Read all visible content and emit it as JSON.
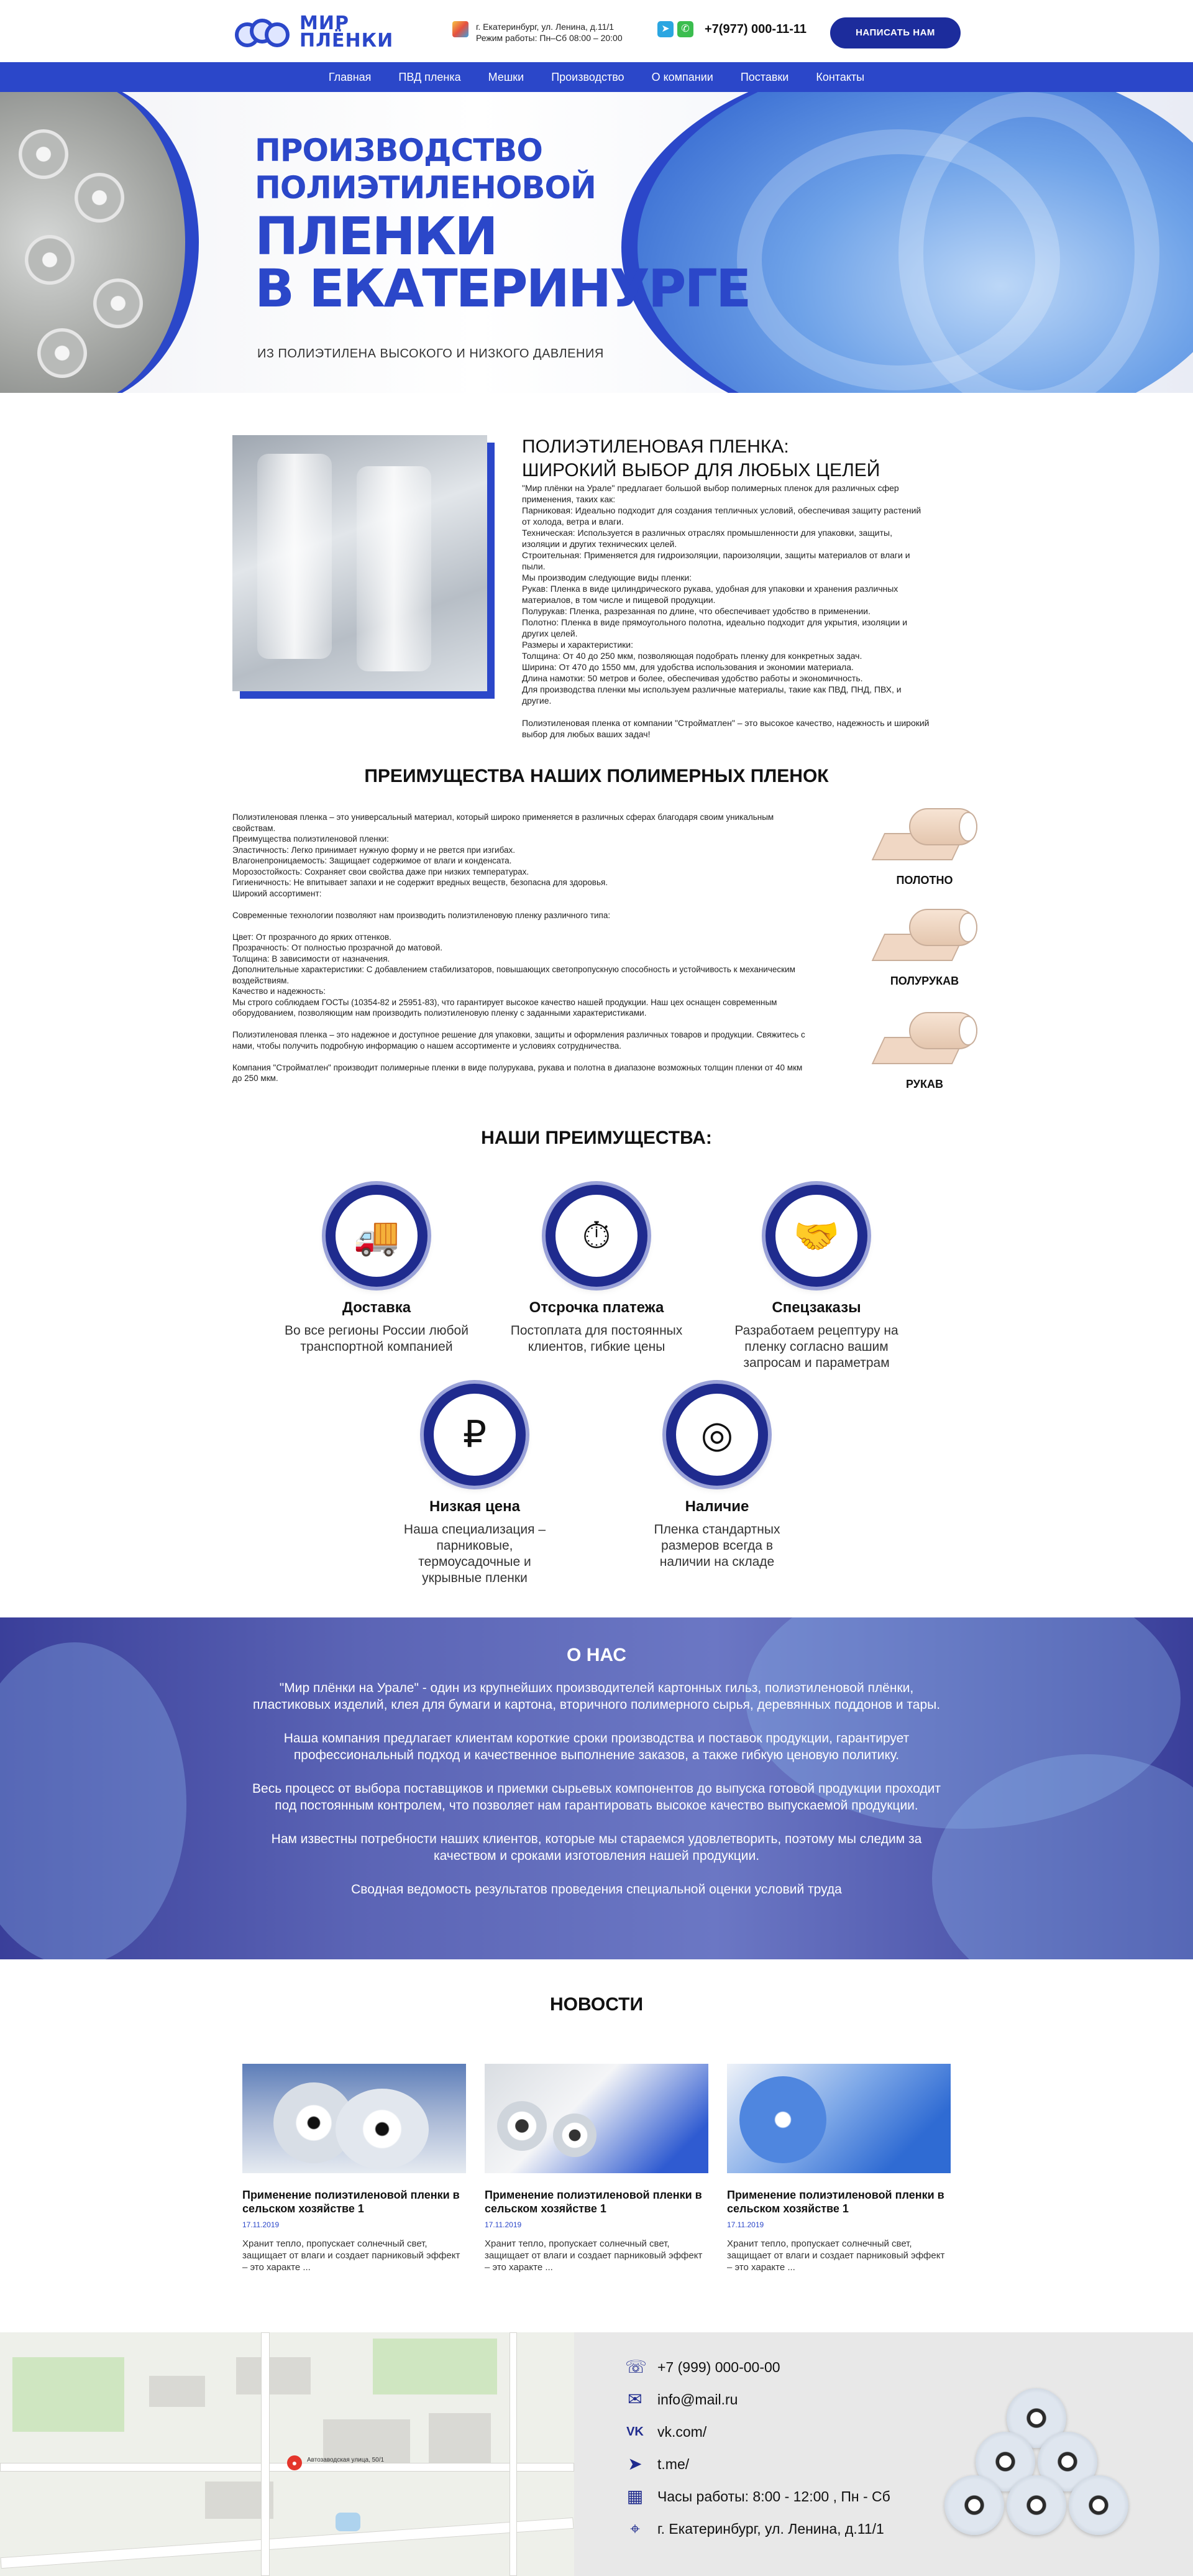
{
  "header": {
    "logo_line1": "МИР",
    "logo_line2": "ПЛЁНКИ",
    "address": "г. Екатеринбург, ул. Ленина, д.11/1",
    "hours": "Режим работы: Пн–Сб 08:00 – 20:00",
    "phone": "+7(977) 000-11-11",
    "cta": "НАПИСАТЬ НАМ"
  },
  "nav": [
    "Главная",
    "ПВД пленка",
    "Мешки",
    "Производство",
    "О компании",
    "Поставки",
    "Контакты"
  ],
  "hero": {
    "title_line1": "Производство",
    "title_line2": "полиэтиленовой",
    "title_line3": "пленки",
    "title_line4": "в Екатеринурге",
    "subtitle": "ИЗ ПОЛИЭТИЛЕНА ВЫСОКОГО И НИЗКОГО ДАВЛЕНИЯ"
  },
  "intro": {
    "title_line1": "ПОЛИЭТИЛЕНОВАЯ ПЛЕНКА:",
    "title_line2": "ШИРОКИЙ ВЫБОР ДЛЯ ЛЮБЫХ ЦЕЛЕЙ",
    "paragraphs": [
      "\"Мир плёнки на Урале\" предлагает большой выбор полимерных пленок для различных сфер применения, таких как:",
      "Парниковая: Идеально подходит для создания тепличных условий, обеспечивая защиту растений от холода, ветра и влаги.",
      "Техническая: Используется в различных отраслях промышленности для упаковки, защиты, изоляции и других технических целей.",
      "Строительная: Применяется для гидроизоляции, пароизоляции, защиты материалов от влаги и пыли.",
      "Мы производим следующие виды пленки:",
      "Рукав: Пленка в виде цилиндрического рукава, удобная для упаковки и хранения различных материалов, в том числе и пищевой продукции.",
      "Полурукав: Пленка, разрезанная по длине, что обеспечивает удобство в применении.",
      "Полотно: Пленка в виде прямоугольного полотна, идеально подходит для укрытия, изоляции и других целей.",
      "Размеры и характеристики:",
      "Толщина: От 40 до 250 мкм, позволяющая подобрать пленку для конкретных задач.",
      "Ширина: От 470 до 1550 мм, для удобства использования и экономии материала.",
      "Длина намотки: 50 метров и более, обеспечивая удобство работы и экономичность.",
      "Для производства пленки мы используем различные материалы, такие как ПВД, ПНД, ПВХ, и другие.",
      "",
      "Полиэтиленовая пленка от компании \"Стройматлен\" – это высокое качество, надежность и широкий выбор для любых ваших задач!"
    ]
  },
  "polymer": {
    "title": "ПРЕИМУЩЕСТВА НАШИХ ПОЛИМЕРНЫХ ПЛЕНОК",
    "paragraphs": [
      "Полиэтиленовая пленка – это универсальный материал, который широко применяется в различных сферах благодаря своим уникальным свойствам.",
      "Преимущества полиэтиленовой пленки:",
      " Эластичность: Легко принимает нужную форму и не рвется при изгибах.",
      " Влагонепроницаемость: Защищает содержимое от влаги и конденсата.",
      " Морозостойкость: Сохраняет свои свойства даже при низких температурах.",
      " Гигиеничность: Не впитывает запахи и не содержит вредных веществ, безопасна для здоровья.",
      "Широкий ассортимент:",
      "",
      "Современные технологии позволяют нам производить полиэтиленовую пленку различного типа:",
      "",
      "Цвет: От прозрачного до ярких оттенков.",
      "Прозрачность: От полностью прозрачной до матовой.",
      "Толщина: В зависимости от назначения.",
      "Дополнительные характеристики: С добавлением стабилизаторов, повышающих светопропускную способность и устойчивость к механическим воздействиям.",
      "Качество и надежность:",
      "Мы строго соблюдаем ГОСТы (10354-82 и 25951-83), что гарантирует высокое качество нашей продукции. Наш цех оснащен современным оборудованием, позволяющим нам производить полиэтиленовую пленку с заданными характеристиками.",
      "",
      "Полиэтиленовая пленка – это надежное и доступное решение для упаковки, защиты и оформления различных товаров и продукции. Свяжитесь с нами, чтобы получить подробную информацию о нашем ассортименте и условиях сотрудничества.",
      "",
      "Компания \"Стройматлен\" производит полимерные пленки в виде полурукава, рукава и полотна в диапазоне возможных толщин пленки от 40 мкм до 250 мкм."
    ],
    "types": [
      "ПОЛОТНО",
      "ПОЛУРУКАВ",
      "РУКАВ"
    ]
  },
  "features": {
    "title": "НАШИ ПРЕИМУЩЕСТВА:",
    "items": [
      {
        "icon": "delivery-icon",
        "title": "Доставка",
        "desc": "Во все регионы России любой транспортной компанией"
      },
      {
        "icon": "stopwatch-icon",
        "title": "Отсрочка платежа",
        "desc": "Постоплата для постоянных клиентов, гибкие цены"
      },
      {
        "icon": "handshake-icon",
        "title": "Спецзаказы",
        "desc": "Разработаем рецептуру на пленку согласно вашим запросам и параметрам"
      },
      {
        "icon": "worker-ruble-icon",
        "title": "Низкая цена",
        "desc": "Наша специализация – парниковые, термоусадочные и укрывные пленки"
      },
      {
        "icon": "rolls-icon",
        "title": "Наличие",
        "desc": "Пленка стандартных размеров всегда в наличии на складе"
      }
    ]
  },
  "about": {
    "title": "О НАС",
    "paragraphs": [
      "\"Мир плёнки на Урале\" - один из крупнейших производителей картонных гильз, полиэтиленовой плёнки, пластиковых изделий, клея для бумаги и картона, вторичного полимерного сырья, деревянных поддонов и тары.",
      "Наша компания предлагает клиентам короткие сроки производства и поставок продукции, гарантирует профессиональный подход и качественное выполнение заказов, а также гибкую ценовую политику.",
      "Весь процесс от выбора поставщиков и приемки сырьевых компонентов до выпуска готовой продукции проходит под постоянным контролем, что позволяет нам гарантировать высокое качество выпускаемой продукции.",
      "Нам известны потребности наших клиентов, которые мы стараемся удовлетворить, поэтому мы следим за качеством и сроками изготовления нашей продукции.",
      "Сводная ведомость результатов проведения специальной оценки условий труда"
    ]
  },
  "news": {
    "title": "НОВОСТИ",
    "items": [
      {
        "title": "Применение полиэтиленовой пленки в сельском хозяйстве 1",
        "date": "17.11.2019",
        "text": "Хранит тепло, пропускает солнечный свет, защищает от влаги и создает парниковый эффект – это характе ..."
      },
      {
        "title": "Применение полиэтиленовой пленки в сельском хозяйстве 1",
        "date": "17.11.2019",
        "text": "Хранит тепло, пропускает солнечный свет, защищает от влаги и создает парниковый эффект – это характе ..."
      },
      {
        "title": "Применение полиэтиленовой пленки в сельском хозяйстве 1",
        "date": "17.11.2019",
        "text": "Хранит тепло, пропускает солнечный свет, защищает от влаги и создает парниковый эффект – это характе ..."
      }
    ]
  },
  "footer": {
    "map_label": "Автозаводская улица, 50/1",
    "contacts": [
      {
        "icon": "phone-icon",
        "text": "+7 (999) 000-00-00"
      },
      {
        "icon": "email-icon",
        "text": "info@mail.ru"
      },
      {
        "icon": "vk-icon",
        "text": "vk.com/"
      },
      {
        "icon": "telegram-icon",
        "text": "t.me/"
      },
      {
        "icon": "clock-icon",
        "text": "Часы работы: 8:00 - 12:00 , Пн - Сб"
      },
      {
        "icon": "location-icon",
        "text": "г. Екатеринбург, ул. Ленина, д.11/1"
      }
    ]
  },
  "colors": {
    "brand_blue": "#2b47c9",
    "dark_navy": "#1f2b8e"
  }
}
